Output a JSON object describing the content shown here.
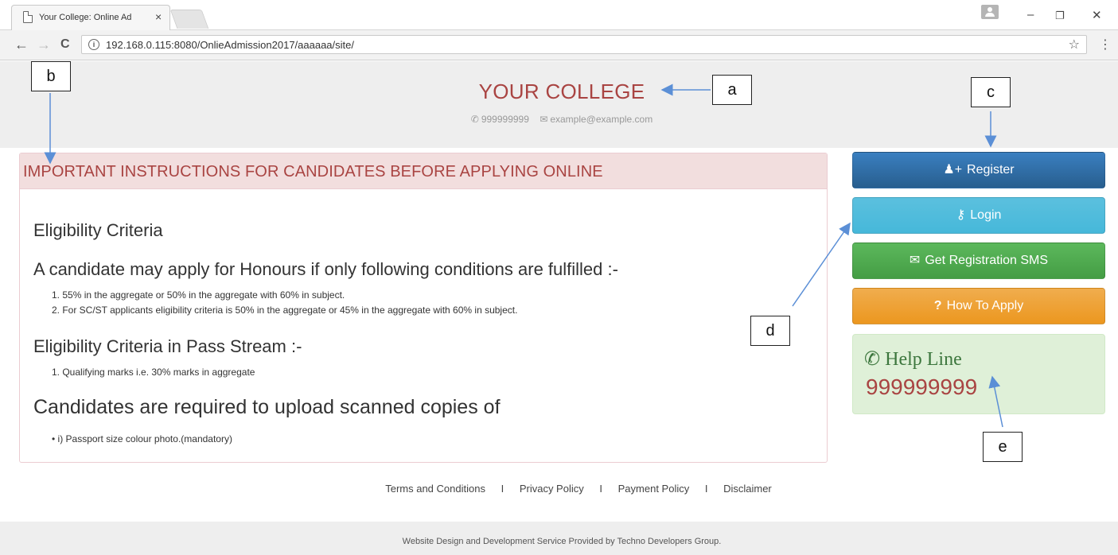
{
  "browser": {
    "tab_title": "Your College: Online Ad",
    "tab_close": "×",
    "url": "192.168.0.115:8080/OnlieAdmission2017/aaaaaa/site/",
    "info_icon": "i",
    "star_icon": "☆",
    "back_icon": "←",
    "forward_icon": "→",
    "reload_icon": "C",
    "menu_icon": "⋮",
    "minimize": "–",
    "restore": "❐",
    "close": "✕"
  },
  "header": {
    "college_name": "YOUR COLLEGE",
    "phone": "999999999",
    "email": "example@example.com",
    "phone_icon": "📞",
    "email_icon": "✉"
  },
  "instructions": {
    "heading": "IMPORTANT INSTRUCTIONS FOR CANDIDATES BEFORE APPLYING ONLINE",
    "eligibility_title": "Eligibility Criteria",
    "honours_title": "A candidate may apply for Honours if only following conditions are fulfilled :-",
    "honours_items": [
      "1.  55% in the aggregate or 50% in the aggregate with 60% in subject.",
      "2.  For SC/ST applicants eligibility criteria is 50% in the aggregate or 45% in the aggregate with 60% in subject."
    ],
    "pass_title": "Eligibility Criteria in Pass Stream :-",
    "pass_items": [
      "1.  Qualifying marks i.e. 30% marks in aggregate"
    ],
    "upload_title": "Candidates are required to upload scanned copies of",
    "upload_items": [
      "•  i) Passport size colour photo.(mandatory)"
    ]
  },
  "sidebar": {
    "register": "Register",
    "login": "Login",
    "sms": "Get Registration SMS",
    "how_to_apply": "How To Apply",
    "register_icon": "👥",
    "login_icon": "⚿",
    "sms_icon": "💬",
    "how_icon": "?",
    "help_title": "Help Line",
    "help_number": "999999999",
    "help_icon": "📞"
  },
  "footer": {
    "links": [
      "Terms and Conditions",
      "Privacy Policy",
      "Payment Policy",
      "Disclaimer"
    ],
    "separator": "I",
    "credit": "Website Design and Development Service Provided by Techno Developers Group."
  },
  "annotations": {
    "a": "a",
    "b": "b",
    "c": "c",
    "d": "d",
    "e": "e"
  },
  "colors": {
    "accent_red": "#a94442",
    "register_blue": "#2e6da4",
    "login_cyan": "#5bc0de",
    "sms_green": "#5cb85c",
    "how_orange": "#f0ad4e",
    "help_bg": "#dff0d8",
    "arrow": "#5b8fd6"
  }
}
